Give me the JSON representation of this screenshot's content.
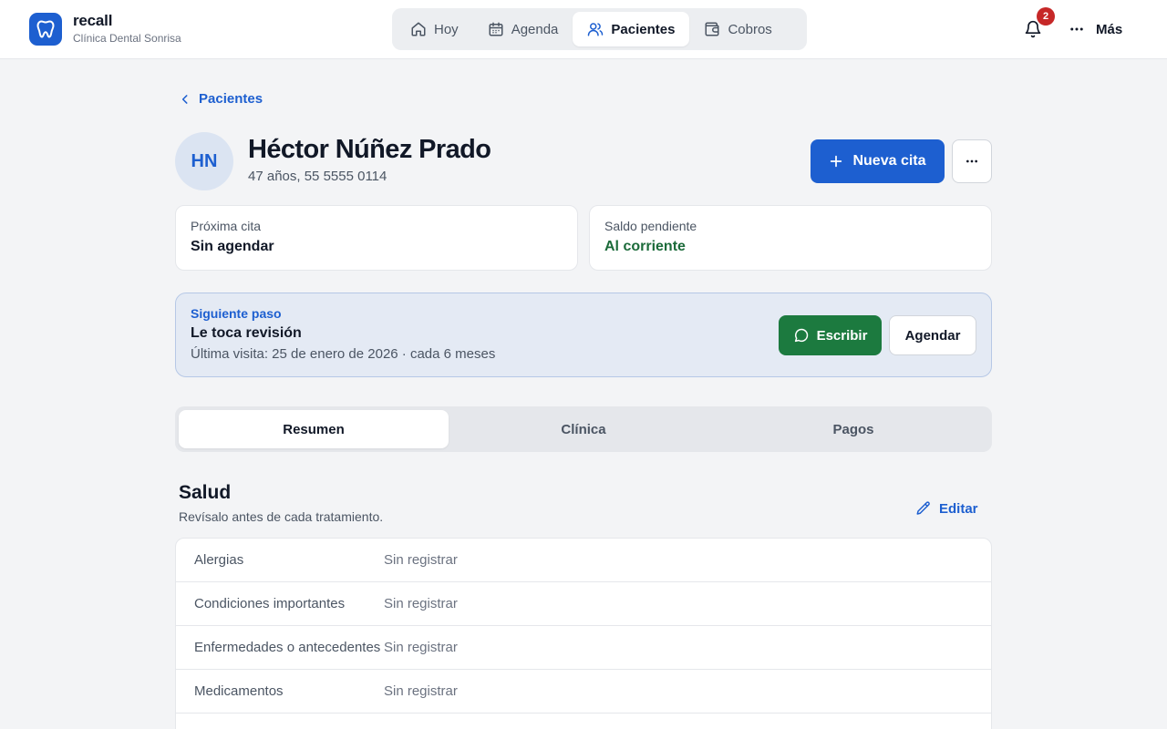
{
  "brand": {
    "name": "recall",
    "clinic": "Clínica Dental Sonrisa"
  },
  "nav": [
    {
      "label": "Hoy",
      "icon": "home-icon",
      "active": false
    },
    {
      "label": "Agenda",
      "icon": "calendar-icon",
      "active": false
    },
    {
      "label": "Pacientes",
      "icon": "users-icon",
      "active": true
    },
    {
      "label": "Cobros",
      "icon": "wallet-icon",
      "active": false
    }
  ],
  "header": {
    "notifications_count": "2",
    "more_label": "Más"
  },
  "breadcrumb": {
    "back_label": "Pacientes"
  },
  "patient": {
    "initials": "HN",
    "name": "Héctor Núñez Prado",
    "info": "47 años, 55 5555 0114"
  },
  "actions": {
    "new_appointment": "Nueva cita"
  },
  "summary_cards": {
    "next_appointment": {
      "label": "Próxima cita",
      "value": "Sin agendar"
    },
    "balance": {
      "label": "Saldo pendiente",
      "value": "Al corriente"
    }
  },
  "next_step": {
    "label": "Siguiente paso",
    "title": "Le toca revisión",
    "subtitle": "Última visita: 25 de enero de 2026 · cada 6 meses",
    "write_label": "Escribir",
    "schedule_label": "Agendar"
  },
  "tabs": [
    {
      "label": "Resumen",
      "active": true
    },
    {
      "label": "Clínica",
      "active": false
    },
    {
      "label": "Pagos",
      "active": false
    }
  ],
  "health": {
    "title": "Salud",
    "subtitle": "Revísalo antes de cada tratamiento.",
    "edit_label": "Editar",
    "rows": [
      {
        "label": "Alergias",
        "value": "Sin registrar"
      },
      {
        "label": "Condiciones importantes",
        "value": "Sin registrar"
      },
      {
        "label": "Enfermedades o antecedentes",
        "value": "Sin registrar"
      },
      {
        "label": "Medicamentos",
        "value": "Sin registrar"
      }
    ]
  },
  "colors": {
    "accent": "#1d5fd0",
    "success": "#1c7a3f",
    "danger": "#c62828"
  }
}
